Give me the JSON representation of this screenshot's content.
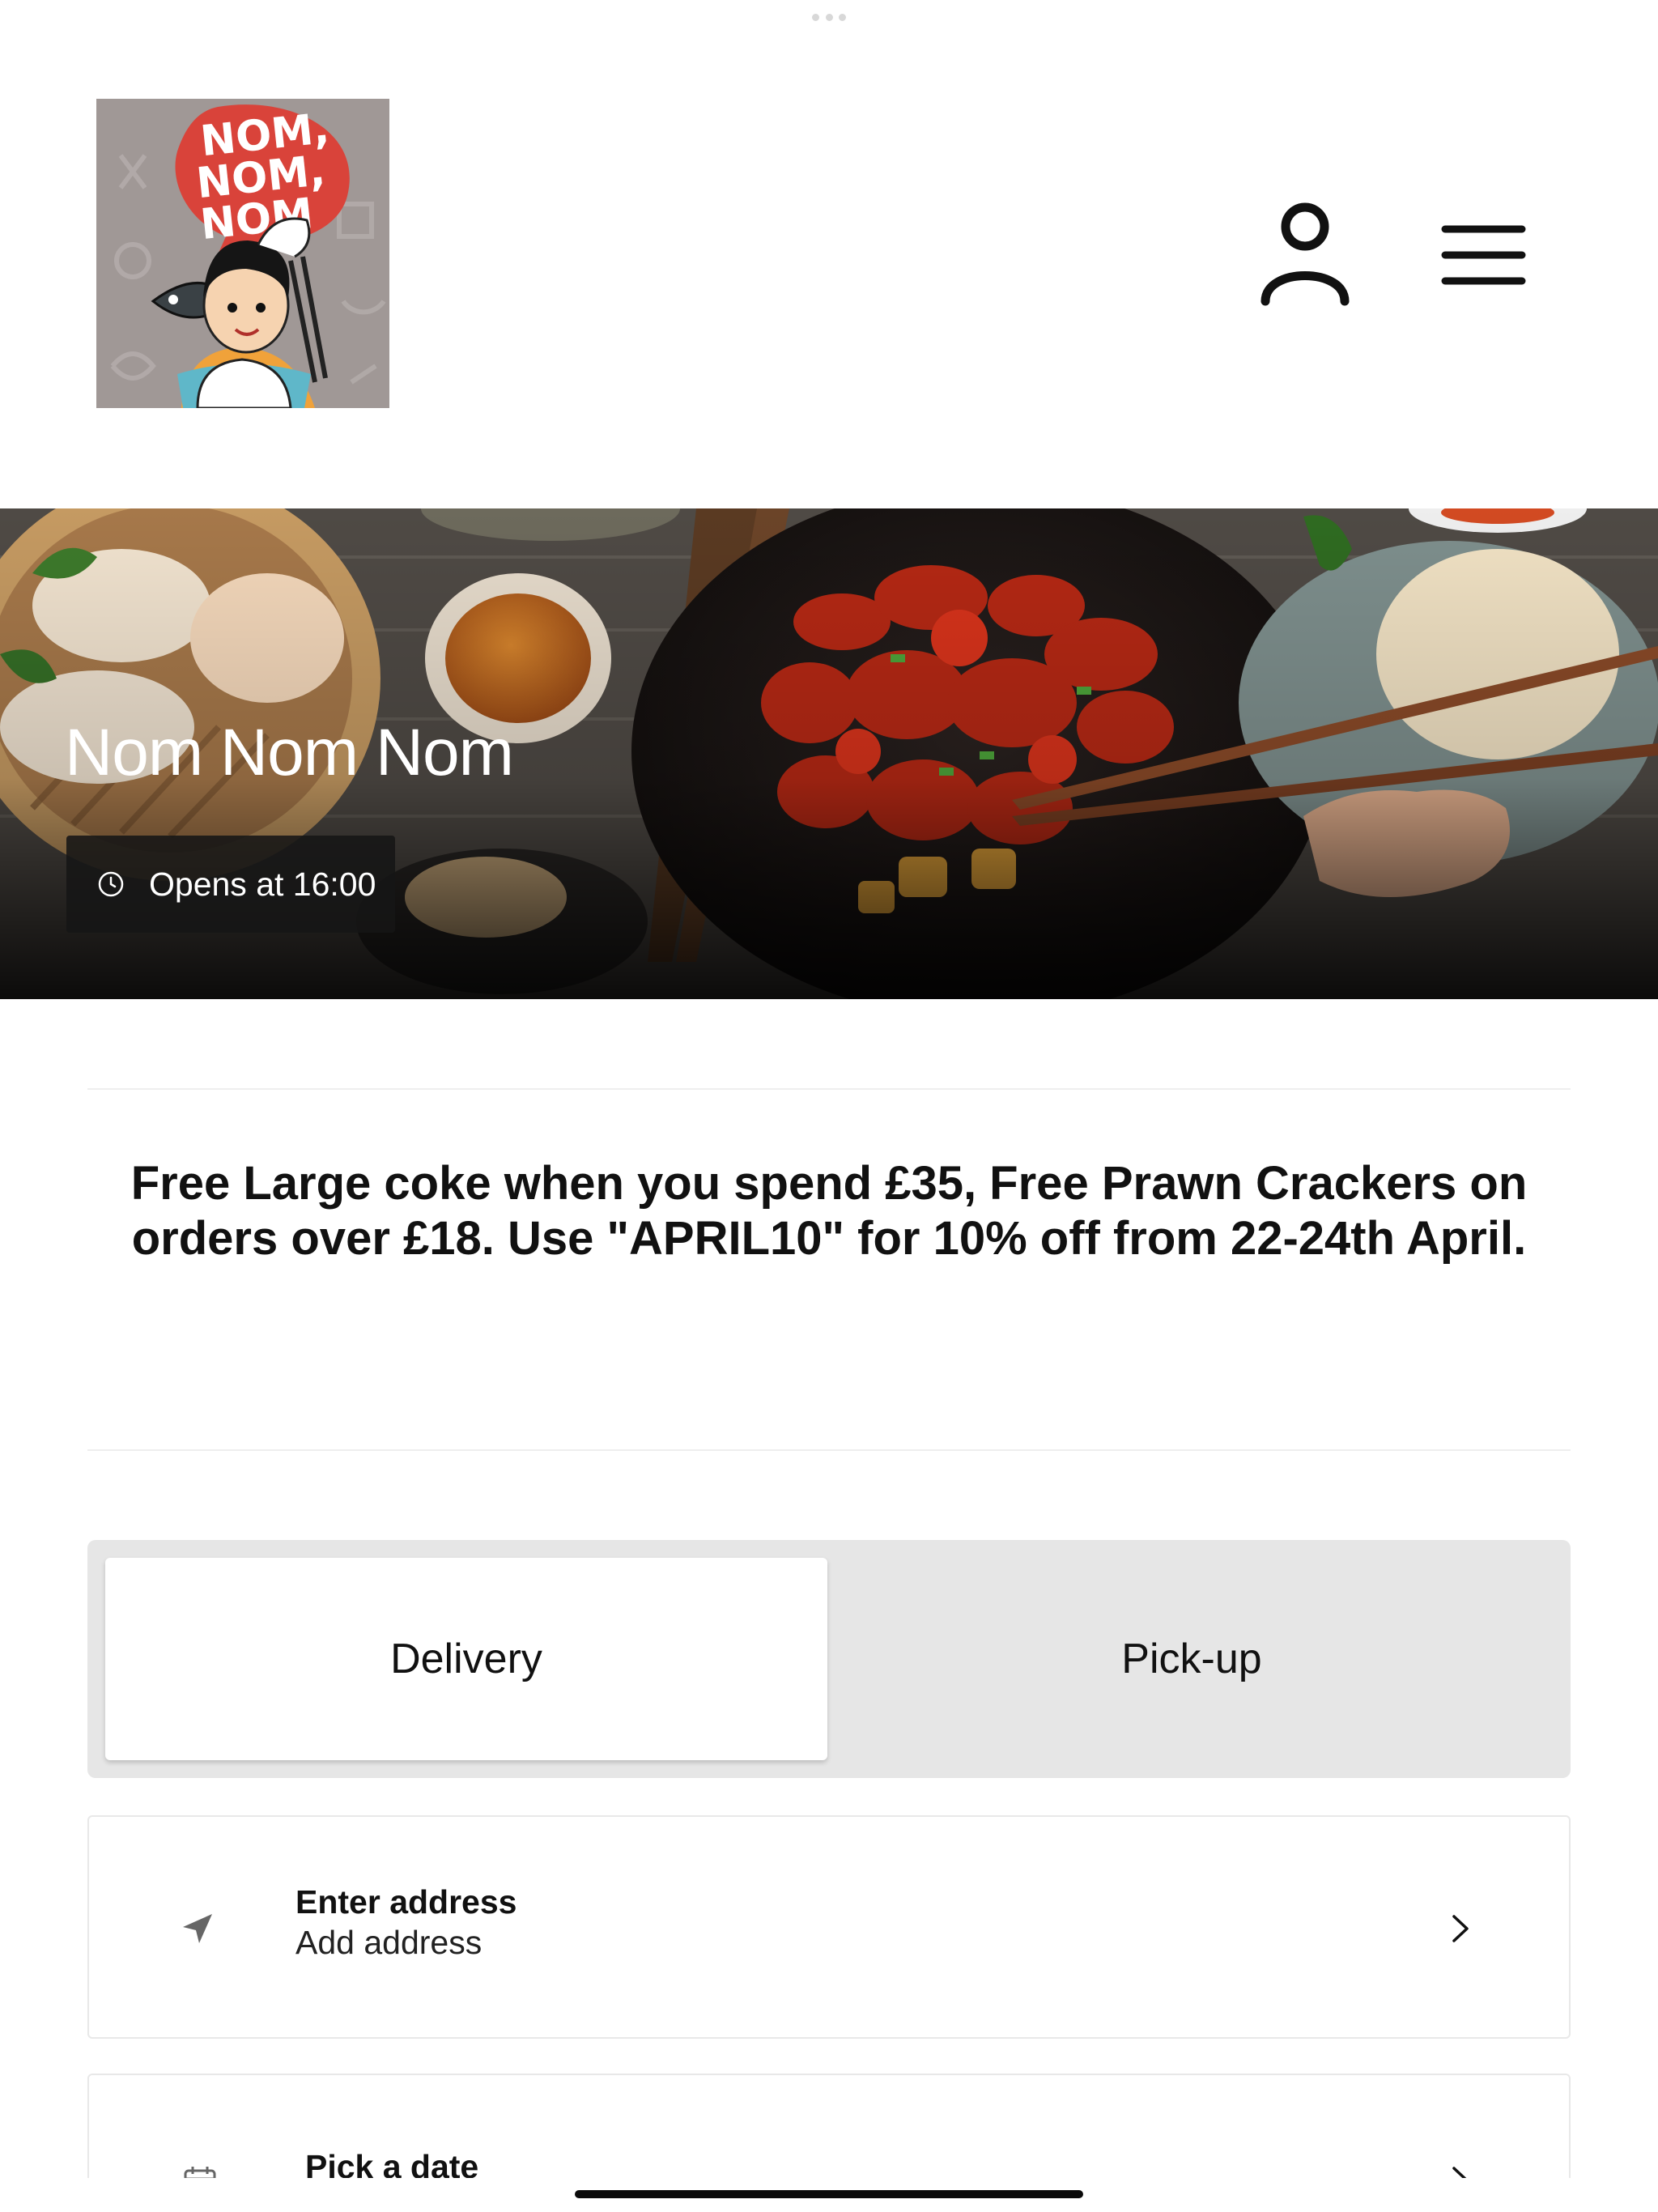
{
  "logo": {
    "lines": [
      "NOM,",
      "NOM,",
      "NOM"
    ]
  },
  "header": {
    "account_icon": "user-icon",
    "menu_icon": "hamburger-menu-icon"
  },
  "hero": {
    "restaurant_name": "Nom Nom Nom",
    "hours_icon": "clock-icon",
    "hours_text": "Opens at 16:00"
  },
  "promo": {
    "line1": "Free Large coke when you spend £35, Free Prawn Crackers on",
    "line2": "orders over £18. Use \"APRIL10\" for 10% off from 22-24th April."
  },
  "order_mode": {
    "options": [
      {
        "label": "Delivery",
        "selected": true
      },
      {
        "label": "Pick-up",
        "selected": false
      }
    ]
  },
  "address_card": {
    "icon": "location-arrow-icon",
    "title": "Enter address",
    "subtitle": "Add address",
    "chevron_icon": "chevron-right-icon"
  },
  "date_card": {
    "icon": "calendar-icon",
    "title": "Pick a date",
    "chevron_icon": "chevron-right-icon"
  },
  "colors": {
    "logo_background": "#a09896",
    "logo_bubble": "#d9433a",
    "toggle_background": "#e6e6e6",
    "text": "#111111"
  }
}
